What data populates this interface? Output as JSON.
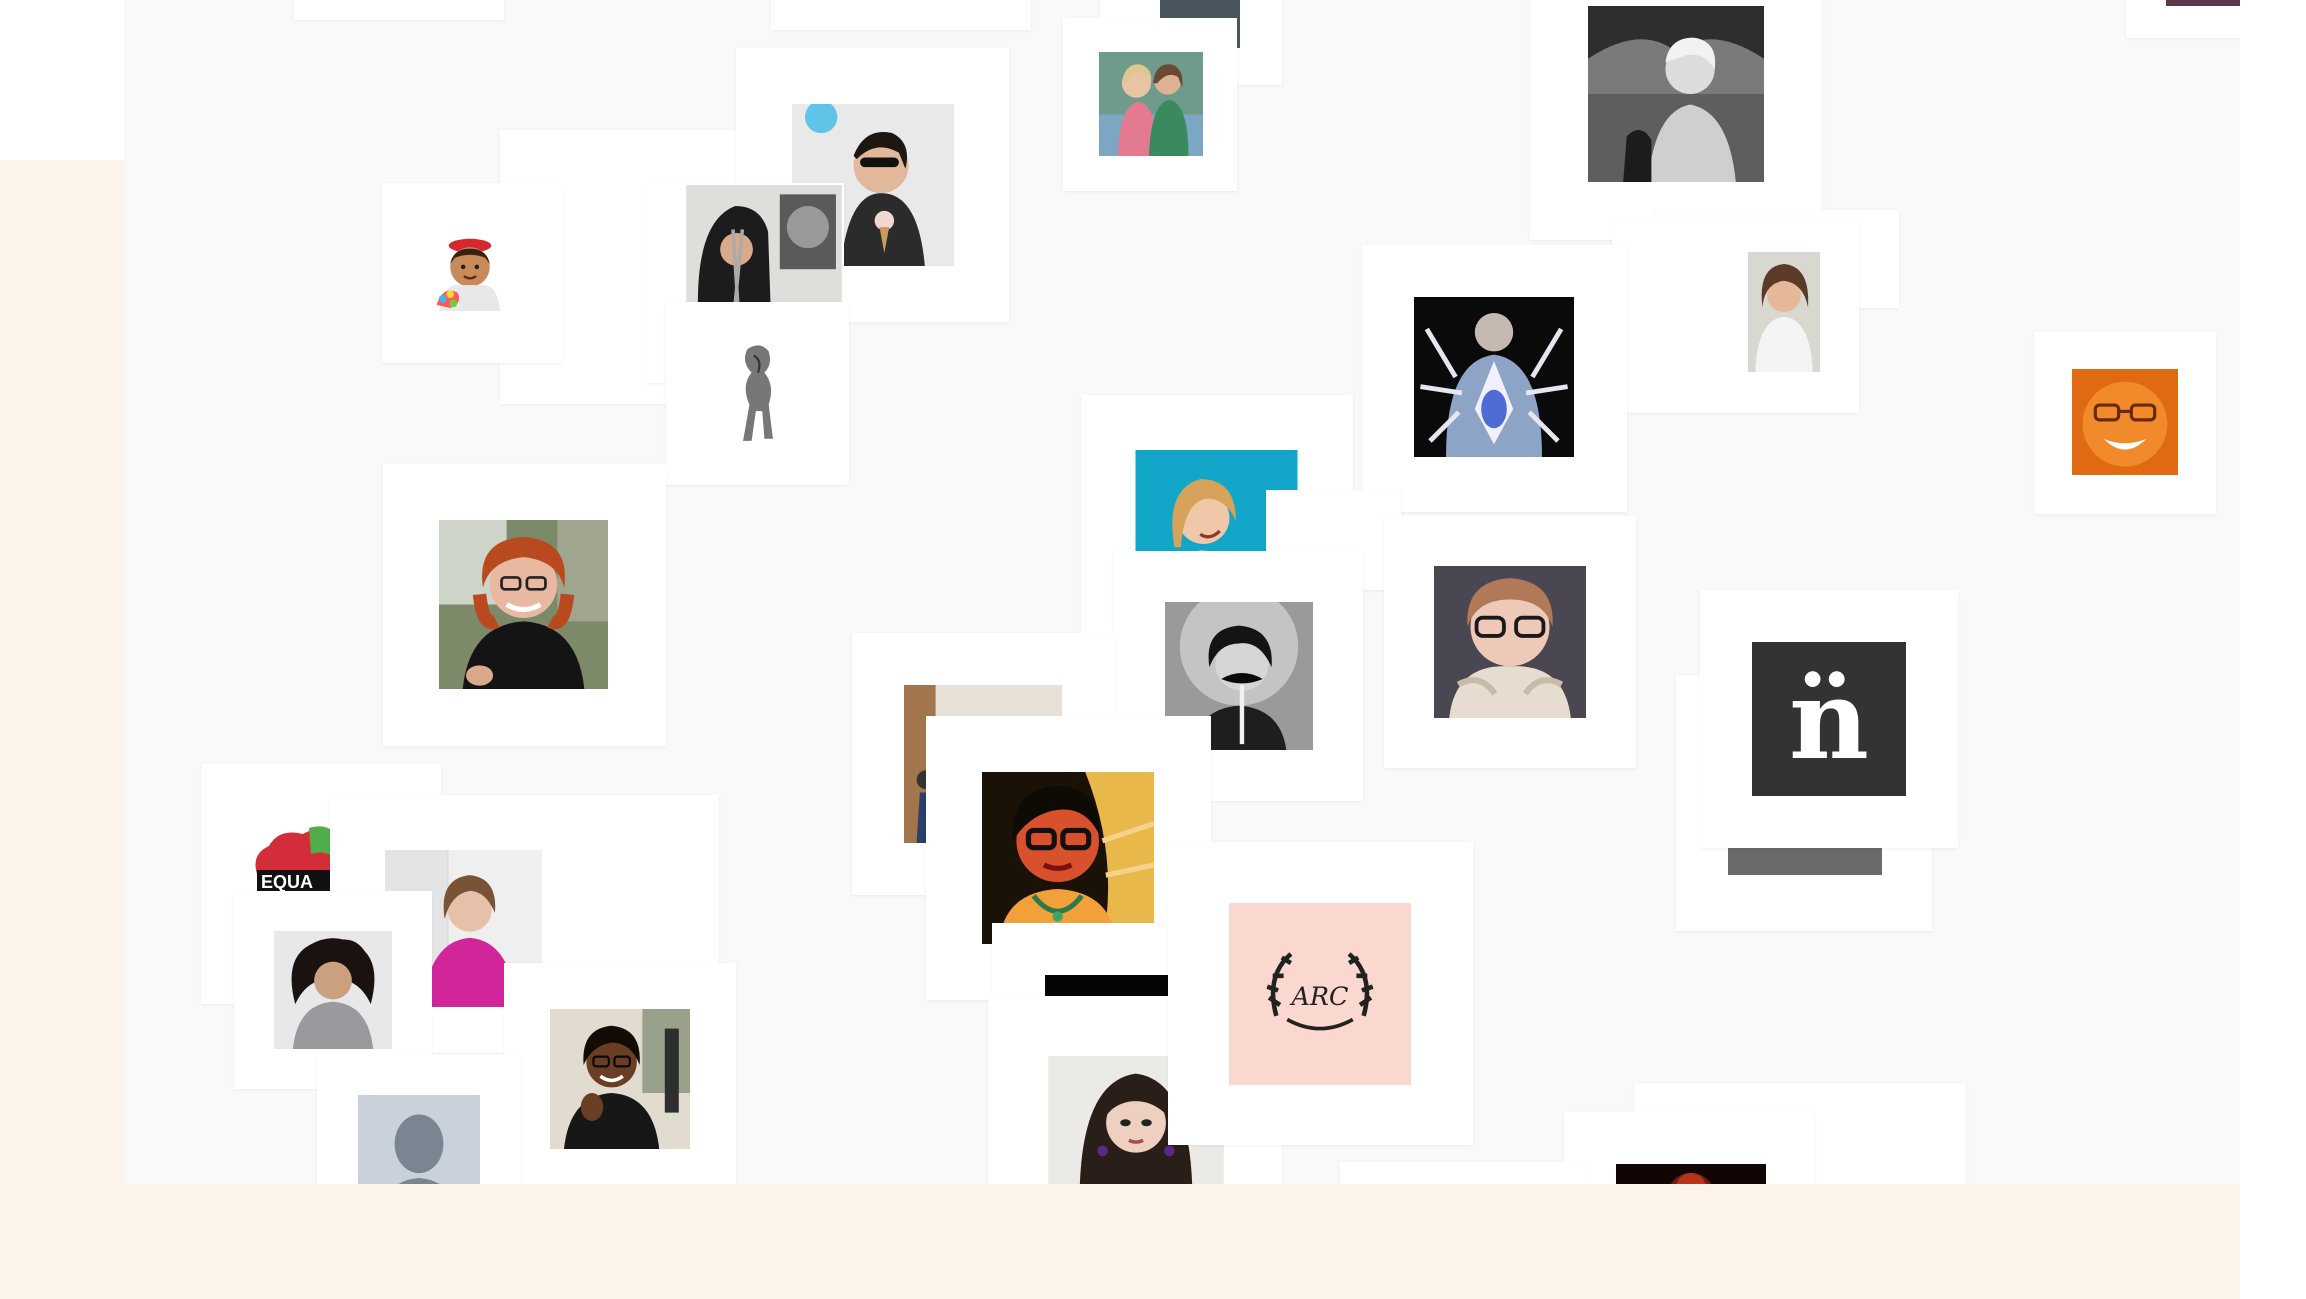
{
  "colors": {
    "page_background": "#ffffff",
    "cream_background": "#fcf4eb",
    "collage_background": "#f9f9f9",
    "card_background": "#ffffff"
  },
  "cards": [
    {
      "name": "portrait-card-1",
      "icon": "person-photo"
    },
    {
      "name": "portrait-card-2",
      "icon": "emoji-artist-icon"
    },
    {
      "name": "portrait-card-3",
      "icon": "person-photo"
    },
    {
      "name": "portrait-card-4",
      "icon": "person-photo"
    },
    {
      "name": "portrait-card-5",
      "icon": "person-photo"
    },
    {
      "name": "portrait-card-6",
      "icon": "default-avatar-icon"
    },
    {
      "name": "logo-card-n",
      "icon": "n-umlaut-logo",
      "logo_text": "n̈"
    },
    {
      "name": "monogram-card",
      "icon": "wreath-monogram-logo",
      "logo_text": "ARC"
    },
    {
      "name": "equality-card",
      "icon": "equality-logo",
      "logo_text": "EQUA"
    }
  ]
}
